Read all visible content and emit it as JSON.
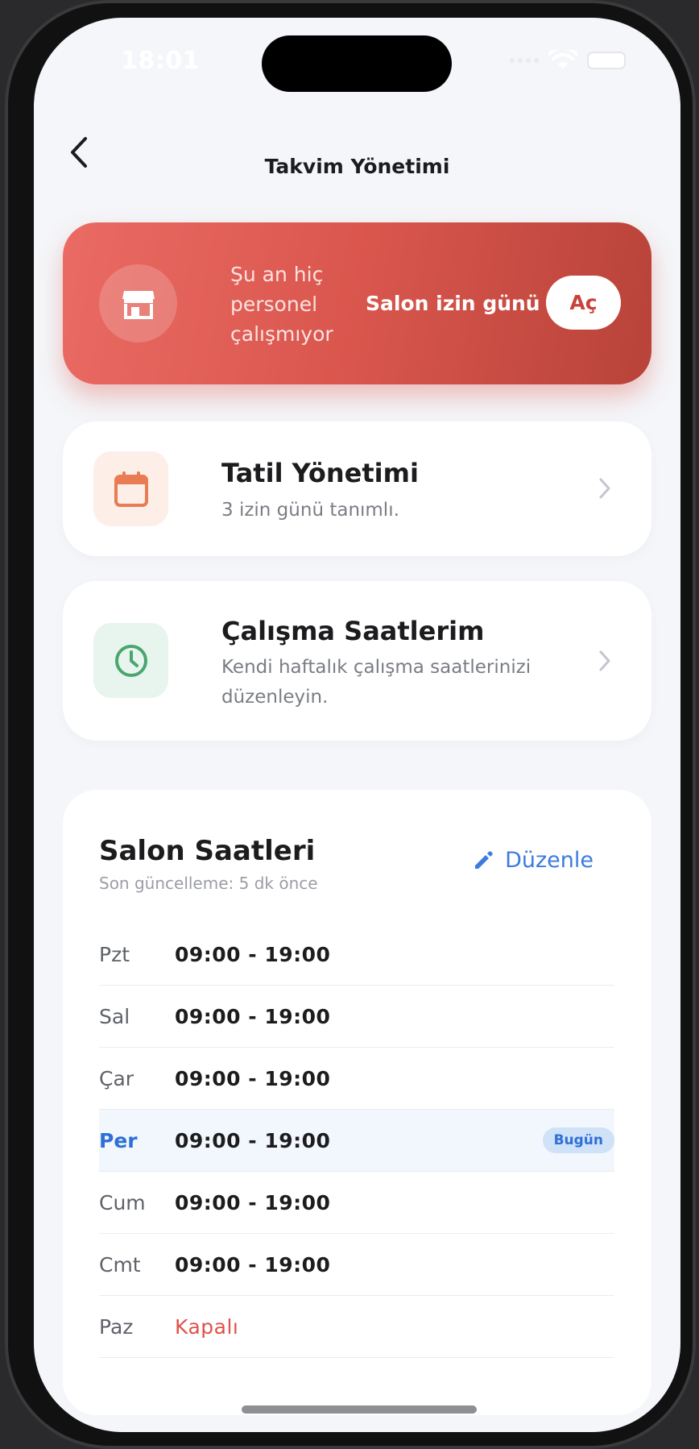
{
  "status_bar": {
    "time": "18:01"
  },
  "nav": {
    "title": "Takvim Yönetimi"
  },
  "banner": {
    "text": "Şu an hiç personel çalışmıyor",
    "offday_label": "Salon izin günü",
    "open_label": "Aç",
    "colors": {
      "start": "#ea6b64",
      "end": "#b84339"
    }
  },
  "holiday_card": {
    "title": "Tatil Yönetimi",
    "subtitle": "3 izin günü tanımlı."
  },
  "work_hours_card": {
    "title": "Çalışma Saatlerim",
    "subtitle": "Kendi haftalık çalışma saatlerinizi düzenleyin."
  },
  "salon_hours": {
    "title": "Salon Saatleri",
    "updated": "Son güncelleme: 5 dk önce",
    "edit_label": "Düzenle",
    "today_badge": "Bugün",
    "rows": [
      {
        "day": "Pzt",
        "time": "09:00 - 19:00"
      },
      {
        "day": "Sal",
        "time": "09:00 - 19:00"
      },
      {
        "day": "Çar",
        "time": "09:00 - 19:00"
      },
      {
        "day": "Per",
        "time": "09:00 - 19:00"
      },
      {
        "day": "Cum",
        "time": "09:00 - 19:00"
      },
      {
        "day": "Cmt",
        "time": "09:00 - 19:00"
      },
      {
        "day": "Paz",
        "time": "Kapalı"
      }
    ]
  },
  "icons": {
    "back": "chevron-left-icon",
    "store": "store-icon",
    "calendar": "calendar-icon",
    "clock": "clock-icon",
    "edit": "pencil-icon",
    "chevron": "chevron-right-icon"
  }
}
